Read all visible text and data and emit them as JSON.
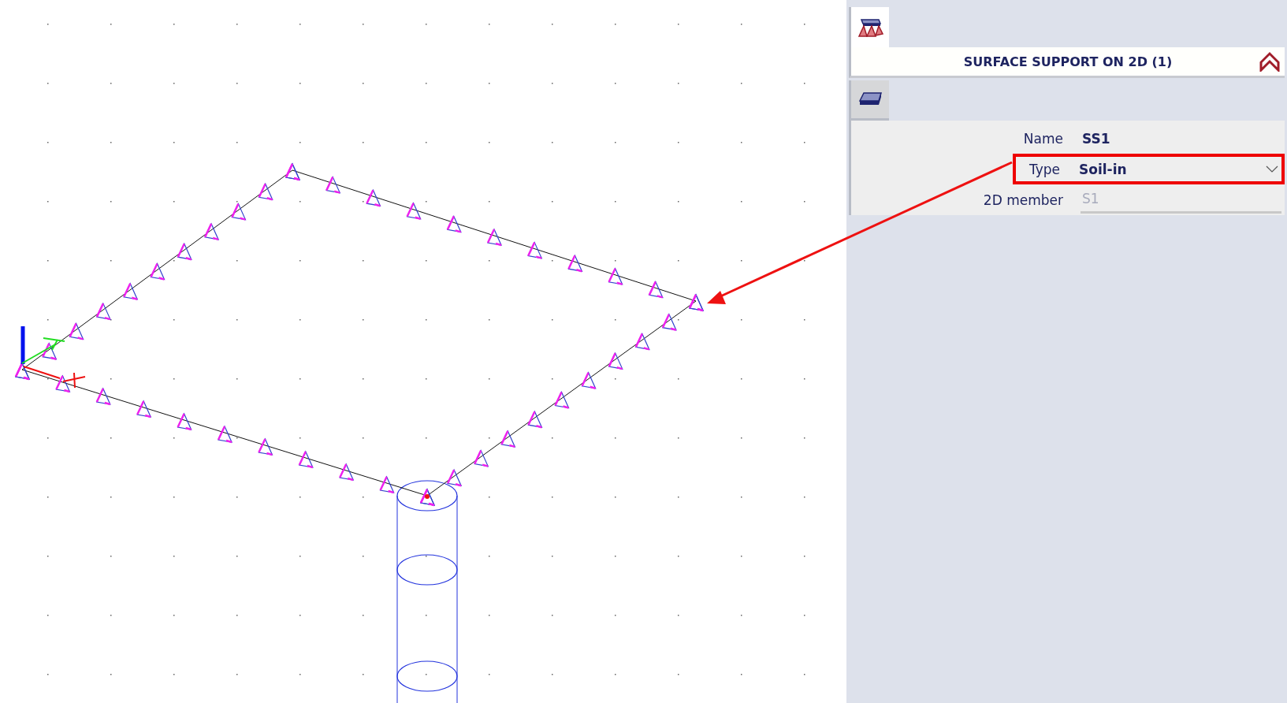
{
  "panel": {
    "title": "SURFACE SUPPORT ON 2D (1)",
    "properties": [
      {
        "label": "Name",
        "value": "SS1",
        "kind": "text",
        "disabled": false,
        "highlighted": false
      },
      {
        "label": "Type",
        "value": "Soil-in",
        "kind": "dropdown",
        "disabled": false,
        "highlighted": true
      },
      {
        "label": "2D member",
        "value": "S1",
        "kind": "text",
        "disabled": true,
        "highlighted": false
      }
    ]
  }
}
